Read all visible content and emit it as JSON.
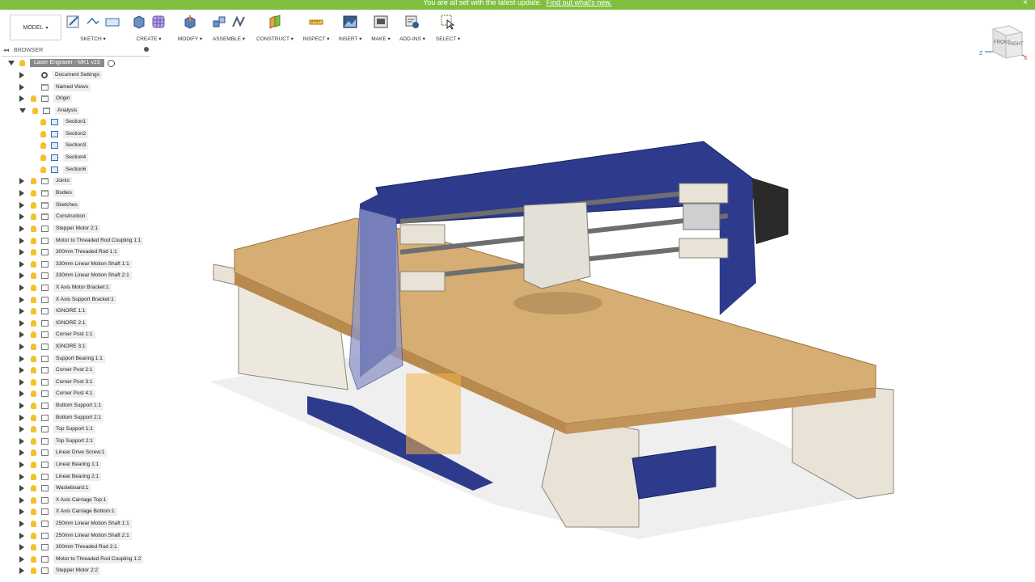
{
  "banner": {
    "message": "You are all set with the latest update.",
    "link": "Find out what's new.",
    "close": "×"
  },
  "workspace": {
    "label": "MODEL",
    "caret": "▾"
  },
  "toolbar": {
    "groups": [
      {
        "label": "SKETCH ▾"
      },
      {
        "label": "CREATE ▾"
      },
      {
        "label": "MODIFY ▾"
      },
      {
        "label": "ASSEMBLE ▾"
      },
      {
        "label": "CONSTRUCT ▾"
      },
      {
        "label": "INSPECT ▾"
      },
      {
        "label": "INSERT ▾"
      },
      {
        "label": "MAKE ▾"
      },
      {
        "label": "ADD-INS ▾"
      },
      {
        "label": "SELECT ▾"
      }
    ]
  },
  "browser": {
    "title": "BROWSER",
    "collapse": "◂◂",
    "root": "Laser Engraver - MK1 v23",
    "items": [
      {
        "label": "Document Settings"
      },
      {
        "label": "Named Views"
      },
      {
        "label": "Origin"
      },
      {
        "label": "Analysis"
      },
      {
        "label": "Section1"
      },
      {
        "label": "Section2"
      },
      {
        "label": "Section3"
      },
      {
        "label": "Section4"
      },
      {
        "label": "Section6"
      },
      {
        "label": "Joints"
      },
      {
        "label": "Bodies"
      },
      {
        "label": "Sketches"
      },
      {
        "label": "Construction"
      },
      {
        "label": "Stepper Motor 2:1"
      },
      {
        "label": "Motor to Threaded Rod Coupling 1:1"
      },
      {
        "label": "300mm Threaded Rod 1:1"
      },
      {
        "label": "330mm Linear Motion Shaft 1:1"
      },
      {
        "label": "330mm Linear Motion Shaft 2:1"
      },
      {
        "label": "X Axis Motor Bracket:1"
      },
      {
        "label": "X Axis Support Bracket:1"
      },
      {
        "label": "IGNORE 1:1"
      },
      {
        "label": "IGNORE 2:1"
      },
      {
        "label": "Corner Post 1:1"
      },
      {
        "label": "IGNORE 3:1"
      },
      {
        "label": "Support Bearing 1:1"
      },
      {
        "label": "Corner Post 2:1"
      },
      {
        "label": "Corner Post 3:1"
      },
      {
        "label": "Corner Post 4:1"
      },
      {
        "label": "Bottom Support 1:1"
      },
      {
        "label": "Bottom Support 2:1"
      },
      {
        "label": "Top Support 1:1"
      },
      {
        "label": "Top Support 2:1"
      },
      {
        "label": "Linear Drive Screw:1"
      },
      {
        "label": "Linear Bearing 1:1"
      },
      {
        "label": "Linear Bearing 2:1"
      },
      {
        "label": "Wasteboard:1"
      },
      {
        "label": "X Axis Carriage Top:1"
      },
      {
        "label": "X Axis Carriage Bottom:1"
      },
      {
        "label": "250mm Linear Motion Shaft 1:1"
      },
      {
        "label": "250mm Linear Motion Shaft 2:1"
      },
      {
        "label": "300mm Threaded Rod 2:1"
      },
      {
        "label": "Motor to Threaded Rod Coupling 1:2"
      },
      {
        "label": "Stepper Motor 2:2"
      }
    ]
  },
  "viewcube": {
    "front": "FRONT",
    "right": "RIGHT",
    "z_axis": "Z",
    "x_axis": "X"
  },
  "colors": {
    "banner": "#7fbf3f",
    "wood": "#d6ad72",
    "frame_blue": "#2e3a8c",
    "plastic": "#e8e3d6"
  }
}
